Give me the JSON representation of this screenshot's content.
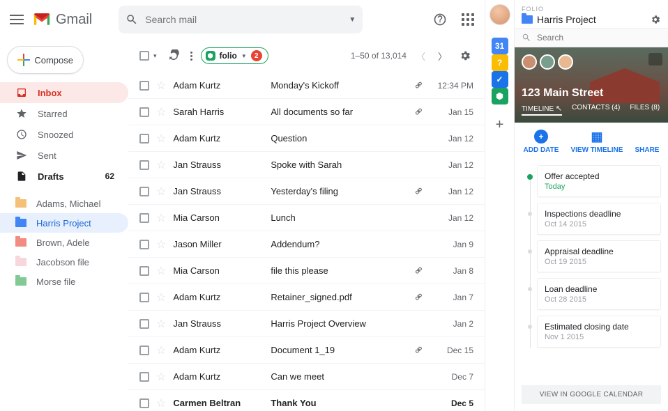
{
  "header": {
    "logo_text": "Gmail",
    "search_placeholder": "Search mail"
  },
  "compose_label": "Compose",
  "nav": [
    {
      "id": "inbox",
      "label": "Inbox",
      "icon": "inbox",
      "active": true
    },
    {
      "id": "starred",
      "label": "Starred",
      "icon": "star"
    },
    {
      "id": "snoozed",
      "label": "Snoozed",
      "icon": "clock"
    },
    {
      "id": "sent",
      "label": "Sent",
      "icon": "send"
    },
    {
      "id": "drafts",
      "label": "Drafts",
      "icon": "file",
      "count": "62",
      "bold": true
    }
  ],
  "labels": [
    {
      "label": "Adams, Michael",
      "color": "#f4c07a"
    },
    {
      "label": "Harris Project",
      "color": "#4285f4",
      "selected": true
    },
    {
      "label": "Brown, Adele",
      "color": "#f28b82"
    },
    {
      "label": "Jacobson file",
      "color": "#f7d7dc"
    },
    {
      "label": "Morse file",
      "color": "#81c995"
    }
  ],
  "folio_chip": {
    "text": "folio",
    "badge": "2"
  },
  "pager": {
    "range": "1–50 of 13,014"
  },
  "mails": [
    {
      "sender": "Adam Kurtz",
      "subject": "Monday's Kickoff",
      "attach": true,
      "date": "12:34 PM"
    },
    {
      "sender": "Sarah Harris",
      "subject": "All documents so far",
      "attach": true,
      "date": "Jan 15"
    },
    {
      "sender": "Adam Kurtz",
      "subject": "Question",
      "attach": false,
      "date": "Jan 12"
    },
    {
      "sender": "Jan Strauss",
      "subject": "Spoke with Sarah",
      "attach": false,
      "date": "Jan 12"
    },
    {
      "sender": "Jan Strauss",
      "subject": "Yesterday's filing",
      "attach": true,
      "date": "Jan 12"
    },
    {
      "sender": "Mia Carson",
      "subject": "Lunch",
      "attach": false,
      "date": "Jan 12"
    },
    {
      "sender": "Jason Miller",
      "subject": "Addendum?",
      "attach": false,
      "date": "Jan 9"
    },
    {
      "sender": "Mia Carson",
      "subject": "file this please",
      "attach": true,
      "date": "Jan 8"
    },
    {
      "sender": "Adam Kurtz",
      "subject": "Retainer_signed.pdf",
      "attach": true,
      "date": "Jan 7"
    },
    {
      "sender": "Jan Strauss",
      "subject": "Harris Project Overview",
      "attach": false,
      "date": "Jan 2"
    },
    {
      "sender": "Adam Kurtz",
      "subject": "Document 1_19",
      "attach": true,
      "date": "Dec 15"
    },
    {
      "sender": "Adam Kurtz",
      "subject": "Can we meet",
      "attach": false,
      "date": "Dec 7"
    },
    {
      "sender": "Carmen Beltran",
      "subject": "Thank You",
      "attach": false,
      "date": "Dec 5",
      "bold": true
    }
  ],
  "strip_icons": [
    {
      "name": "calendar",
      "bg": "#4285f4",
      "text": "31"
    },
    {
      "name": "keep",
      "bg": "#fbbc04",
      "text": "?"
    },
    {
      "name": "tasks",
      "bg": "#1a73e8",
      "text": "✓"
    },
    {
      "name": "folio",
      "bg": "#1aa260",
      "text": "⬢"
    }
  ],
  "folio": {
    "brand": "FOLIO",
    "title": "Harris Project",
    "search_placeholder": "Search",
    "address": "123 Main Street",
    "tabs": [
      {
        "label": "TIMELINE",
        "active": true
      },
      {
        "label": "CONTACTS (4)"
      },
      {
        "label": "FILES (8)"
      }
    ],
    "actions": [
      {
        "label": "ADD DATE"
      },
      {
        "label": "VIEW TIMELINE"
      },
      {
        "label": "SHARE"
      }
    ],
    "timeline": [
      {
        "title": "Offer accepted",
        "date": "Today",
        "active": true
      },
      {
        "title": "Inspections deadline",
        "date": "Oct 14 2015"
      },
      {
        "title": "Appraisal deadline",
        "date": "Oct 19 2015"
      },
      {
        "title": "Loan deadline",
        "date": "Oct 28 2015"
      },
      {
        "title": "Estimated closing date",
        "date": "Nov 1 2015"
      }
    ],
    "calendar_btn": "VIEW IN GOOGLE CALENDAR"
  }
}
